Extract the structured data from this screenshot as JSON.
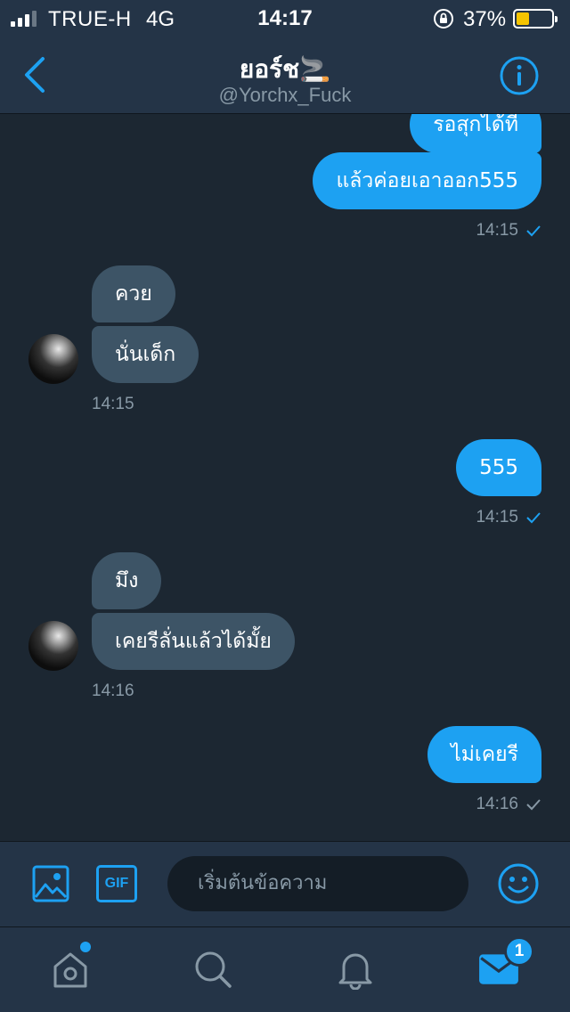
{
  "status_bar": {
    "carrier": "TRUE-H",
    "network": "4G",
    "time": "14:17",
    "battery_percent": "37%",
    "battery_level": 0.37,
    "battery_color": "#f5c400"
  },
  "header": {
    "title": "ยอร์ช🚬",
    "handle": "@Yorchx_Fuck",
    "back_icon": "chevron-left-icon",
    "info_icon": "info-icon"
  },
  "messages": [
    {
      "direction": "out",
      "text": "รอสุกได้ที่"
    },
    {
      "direction": "out",
      "text": "แล้วค่อยเอาออก555",
      "time": "14:15",
      "status": "sent"
    },
    {
      "direction": "in",
      "text": "ควย"
    },
    {
      "direction": "in",
      "text": "นั่นเด็ก",
      "time": "14:15"
    },
    {
      "direction": "out",
      "text": "555",
      "time": "14:15",
      "status": "sent"
    },
    {
      "direction": "in",
      "text": "มึง"
    },
    {
      "direction": "in",
      "text": "เคยรีลั่นแล้วได้มั้ย",
      "time": "14:16"
    },
    {
      "direction": "out",
      "text": "ไม่เคยรี",
      "time": "14:16",
      "status": "delivered"
    }
  ],
  "compose": {
    "placeholder": "เริ่มต้นข้อความ",
    "gif_label": "GIF",
    "image_icon": "image-icon",
    "emoji_icon": "smiley-icon"
  },
  "tabbar": {
    "items": [
      "home-icon",
      "search-icon",
      "bell-icon",
      "mail-icon"
    ],
    "messages_badge": "1"
  },
  "colors": {
    "accent": "#1da1f2",
    "background": "#1c2732",
    "bar": "#243447",
    "incoming_bubble": "#3d5466"
  }
}
